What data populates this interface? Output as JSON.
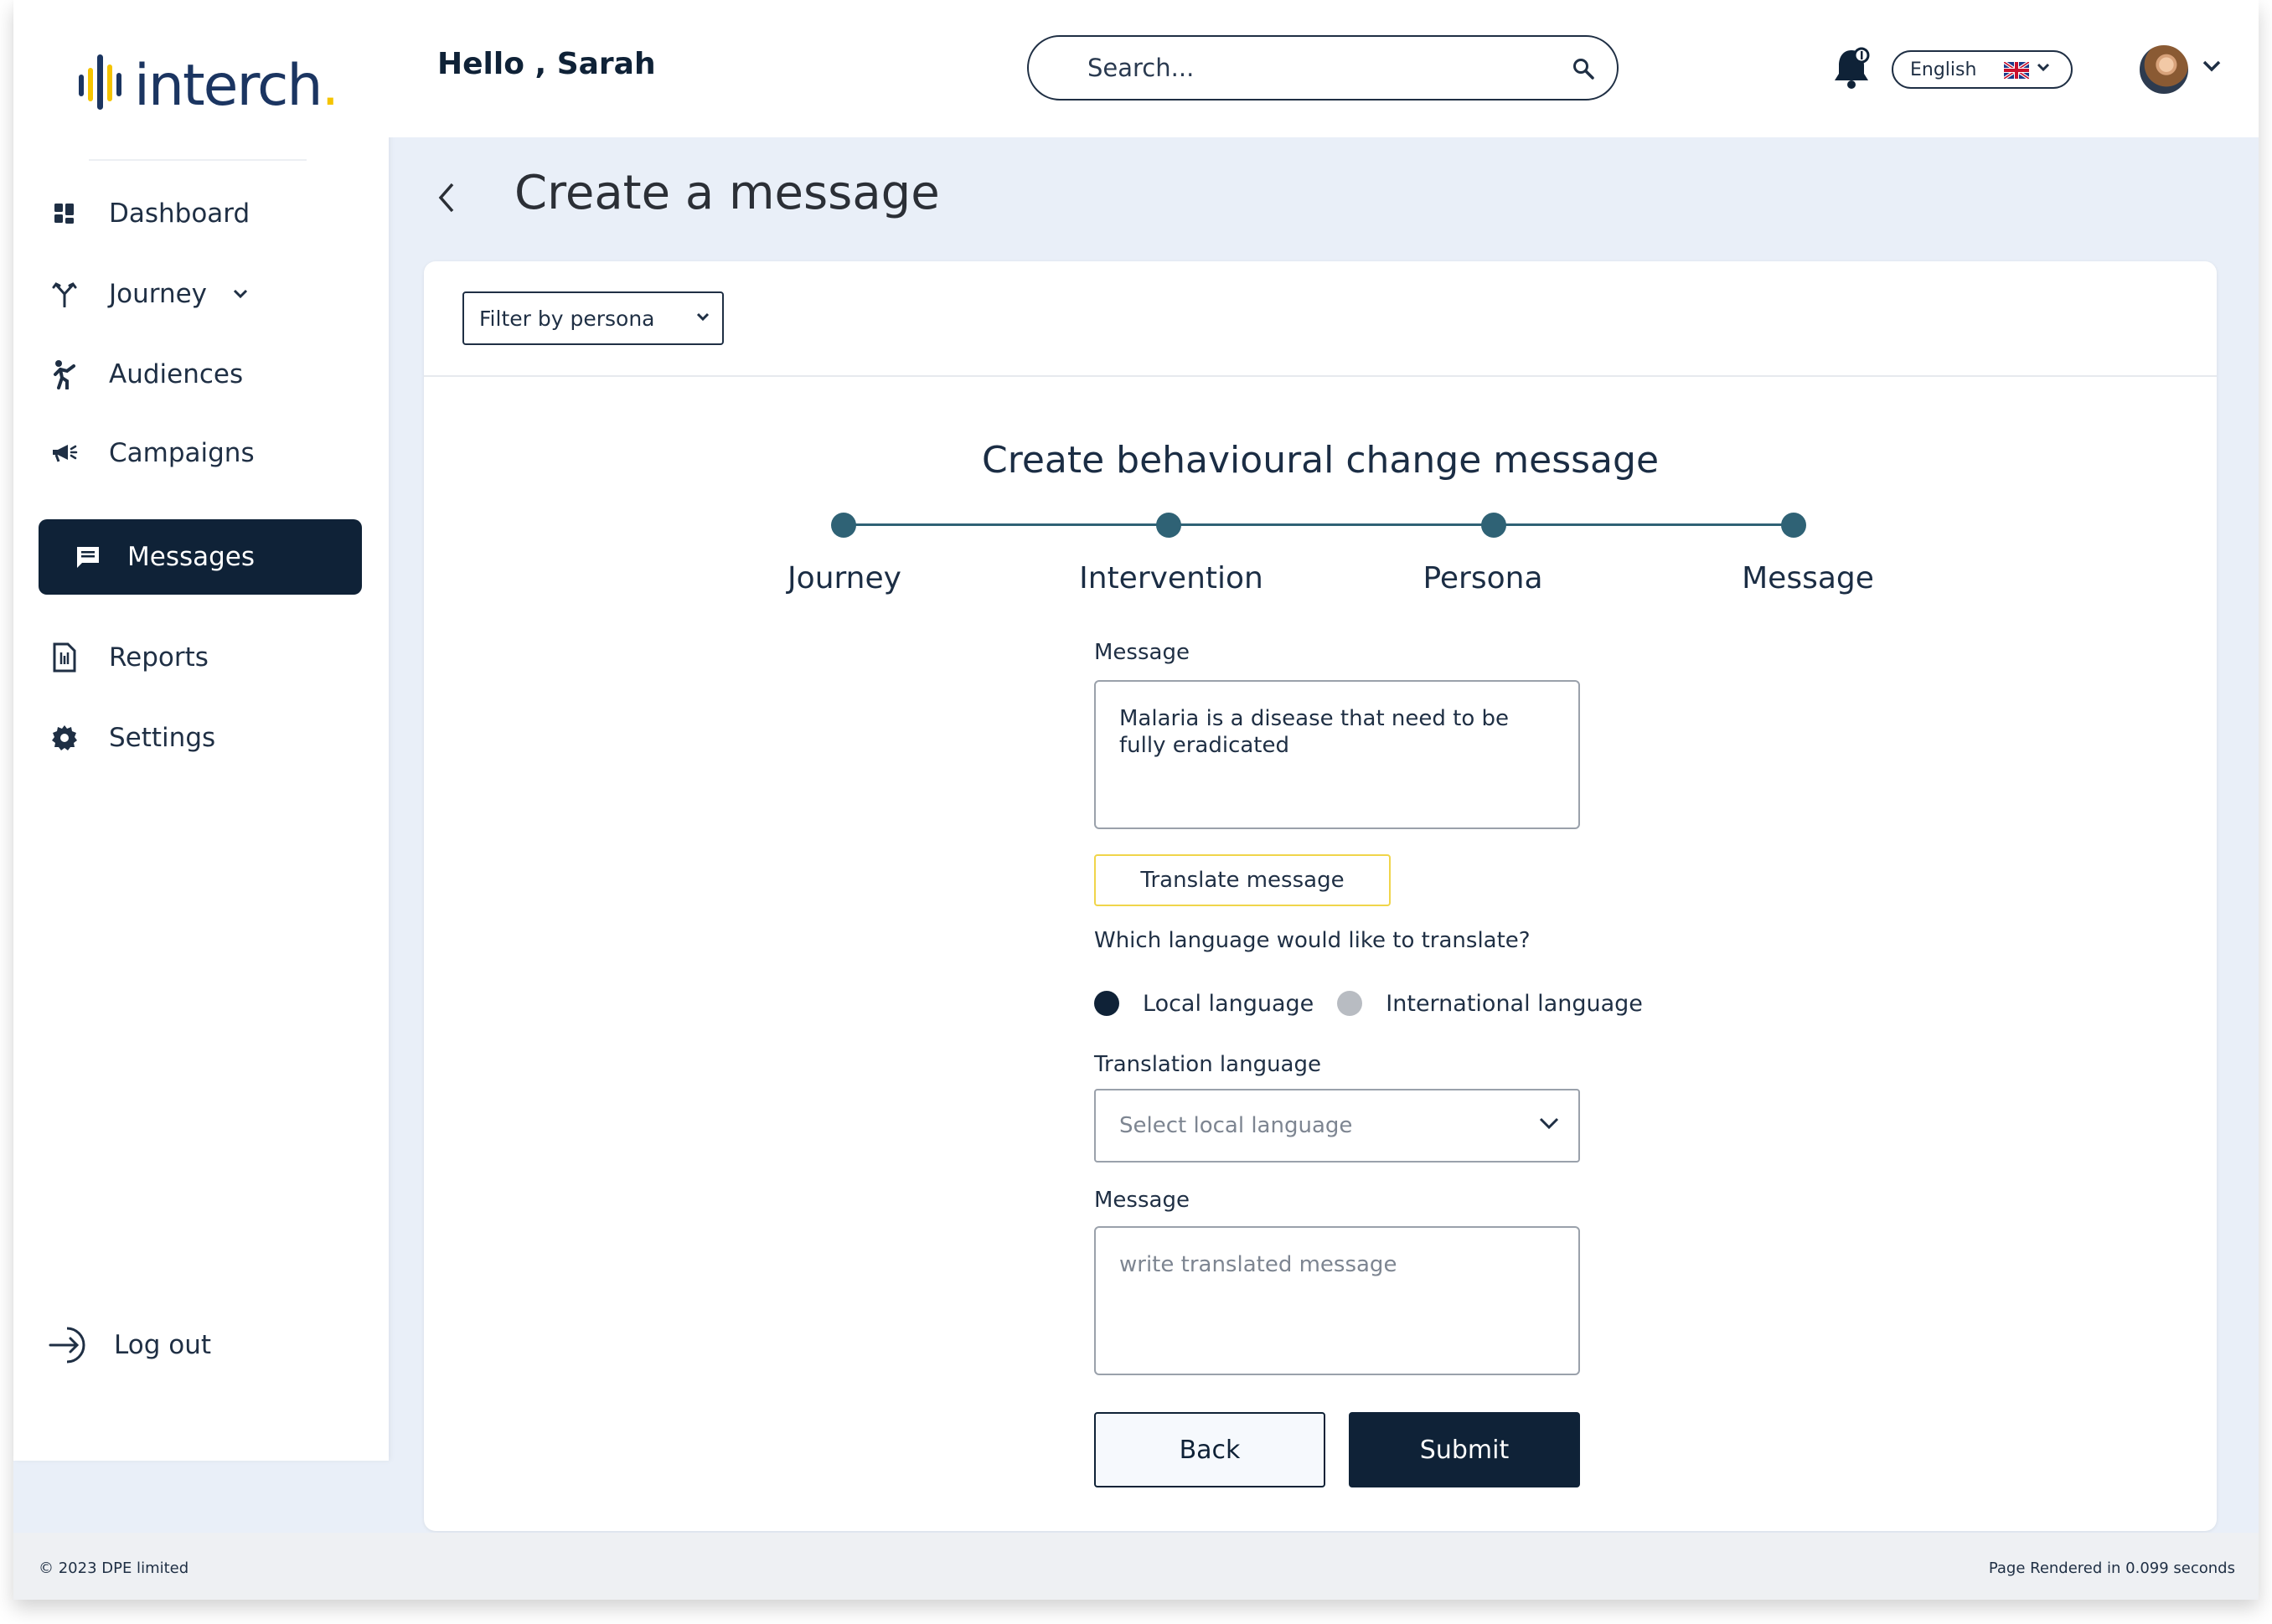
{
  "brand": {
    "logo_text": "interch",
    "logo_dot": ".",
    "accent_color": "#f5c400",
    "primary_color": "#0f2237"
  },
  "sidebar": {
    "items": [
      {
        "label": "Dashboard",
        "icon": "dashboard-grid-icon"
      },
      {
        "label": "Journey",
        "icon": "journey-fork-icon",
        "has_dropdown": true
      },
      {
        "label": "Audiences",
        "icon": "person-walking-icon"
      },
      {
        "label": "Campaigns",
        "icon": "megaphone-icon"
      },
      {
        "label": "Messages",
        "icon": "message-icon",
        "active": true
      },
      {
        "label": "Reports",
        "icon": "report-document-icon"
      },
      {
        "label": "Settings",
        "icon": "gear-icon"
      }
    ],
    "logout_label": "Log out"
  },
  "header": {
    "greeting": "Hello , Sarah",
    "search_placeholder": "Search...",
    "language": "English"
  },
  "page": {
    "title": "Create a message",
    "filter_label": "Filter by persona",
    "form_title": "Create behavioural change message",
    "steps": [
      "Journey",
      "Intervention",
      "Persona",
      "Message"
    ],
    "message_label": "Message",
    "message_value": "Malaria is a disease that need to be fully eradicated",
    "translate_button": "Translate message",
    "question": "Which language would like to translate?",
    "radio_local": "Local language",
    "radio_international": "International language",
    "selected_radio": "Local language",
    "translation_language_label": "Translation language",
    "translation_language_placeholder": "Select local language",
    "translated_message_label": "Message",
    "translated_message_placeholder": "write translated message",
    "back_button": "Back",
    "submit_button": "Submit"
  },
  "footer": {
    "copyright": "© 2023 DPE limited",
    "render_time": "Page Rendered in 0.099 seconds"
  }
}
